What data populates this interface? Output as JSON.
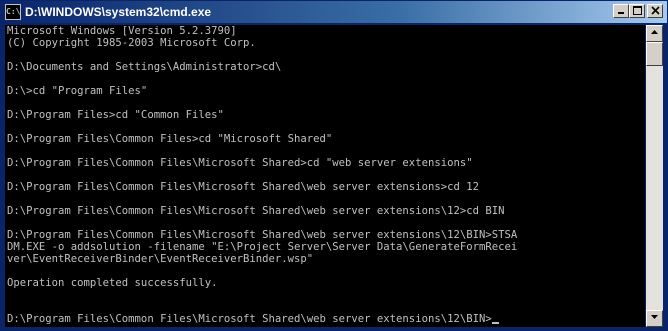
{
  "window": {
    "title": "D:\\WINDOWS\\system32\\cmd.exe",
    "icon": "cmd-window-icon",
    "icon_text": "C:\\",
    "buttons": {
      "minimize": "minimize-icon",
      "maximize": "maximize-icon",
      "close": "close-icon"
    }
  },
  "console": {
    "lines": [
      "Microsoft Windows [Version 5.2.3790]",
      "(C) Copyright 1985-2003 Microsoft Corp.",
      "",
      "D:\\Documents and Settings\\Administrator>cd\\",
      "",
      "D:\\>cd \"Program Files\"",
      "",
      "D:\\Program Files>cd \"Common Files\"",
      "",
      "D:\\Program Files\\Common Files>cd \"Microsoft Shared\"",
      "",
      "D:\\Program Files\\Common Files\\Microsoft Shared>cd \"web server extensions\"",
      "",
      "D:\\Program Files\\Common Files\\Microsoft Shared\\web server extensions>cd 12",
      "",
      "D:\\Program Files\\Common Files\\Microsoft Shared\\web server extensions\\12>cd BIN",
      "",
      "D:\\Program Files\\Common Files\\Microsoft Shared\\web server extensions\\12\\BIN>STSA",
      "DM.EXE -o addsolution -filename \"E:\\Project Server\\Server Data\\GenerateFormRecei",
      "ver\\EventReceiverBinder\\EventReceiverBinder.wsp\"",
      "",
      "Operation completed successfully.",
      "",
      "",
      "D:\\Program Files\\Common Files\\Microsoft Shared\\web server extensions\\12\\BIN>"
    ]
  },
  "scrollbar": {
    "up_icon": "scroll-up-arrow-icon",
    "down_icon": "scroll-down-arrow-icon"
  }
}
